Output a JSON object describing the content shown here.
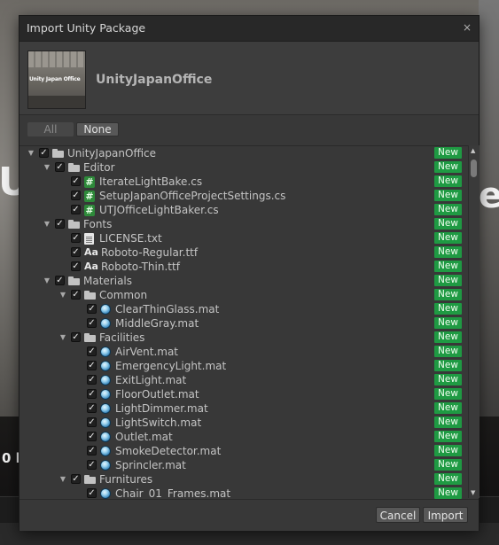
{
  "background": {
    "letter_large_left": "U",
    "letter_large_right": "e",
    "letter_small_left": "0 l"
  },
  "dialog": {
    "title": "Import Unity Package",
    "close_glyph": "×",
    "thumbnail_text": "Unity Japan Office",
    "package_name": "UnityJapanOffice",
    "all_label": "All",
    "none_label": "None",
    "new_badge": "New",
    "cancel_label": "Cancel",
    "import_label": "Import"
  },
  "tree": [
    {
      "label": "UnityJapanOffice",
      "depth": 0,
      "type": "folder",
      "expandable": true,
      "checked": true
    },
    {
      "label": "Editor",
      "depth": 1,
      "type": "folder",
      "expandable": true,
      "checked": true
    },
    {
      "label": "IterateLightBake.cs",
      "depth": 2,
      "type": "script",
      "expandable": false,
      "checked": true
    },
    {
      "label": "SetupJapanOfficeProjectSettings.cs",
      "depth": 2,
      "type": "script",
      "expandable": false,
      "checked": true
    },
    {
      "label": "UTJOfficeLightBaker.cs",
      "depth": 2,
      "type": "script",
      "expandable": false,
      "checked": true
    },
    {
      "label": "Fonts",
      "depth": 1,
      "type": "folder",
      "expandable": true,
      "checked": true
    },
    {
      "label": "LICENSE.txt",
      "depth": 2,
      "type": "doc",
      "expandable": false,
      "checked": true
    },
    {
      "label": "Roboto-Regular.ttf",
      "depth": 2,
      "type": "font",
      "expandable": false,
      "checked": true
    },
    {
      "label": "Roboto-Thin.ttf",
      "depth": 2,
      "type": "font",
      "expandable": false,
      "checked": true
    },
    {
      "label": "Materials",
      "depth": 1,
      "type": "folder",
      "expandable": true,
      "checked": true
    },
    {
      "label": "Common",
      "depth": 2,
      "type": "folder",
      "expandable": true,
      "checked": true
    },
    {
      "label": "ClearThinGlass.mat",
      "depth": 3,
      "type": "mat",
      "expandable": false,
      "checked": true
    },
    {
      "label": "MiddleGray.mat",
      "depth": 3,
      "type": "mat",
      "expandable": false,
      "checked": true
    },
    {
      "label": "Facilities",
      "depth": 2,
      "type": "folder",
      "expandable": true,
      "checked": true
    },
    {
      "label": "AirVent.mat",
      "depth": 3,
      "type": "mat",
      "expandable": false,
      "checked": true
    },
    {
      "label": "EmergencyLight.mat",
      "depth": 3,
      "type": "mat",
      "expandable": false,
      "checked": true
    },
    {
      "label": "ExitLight.mat",
      "depth": 3,
      "type": "mat",
      "expandable": false,
      "checked": true
    },
    {
      "label": "FloorOutlet.mat",
      "depth": 3,
      "type": "mat",
      "expandable": false,
      "checked": true
    },
    {
      "label": "LightDimmer.mat",
      "depth": 3,
      "type": "mat",
      "expandable": false,
      "checked": true
    },
    {
      "label": "LightSwitch.mat",
      "depth": 3,
      "type": "mat",
      "expandable": false,
      "checked": true
    },
    {
      "label": "Outlet.mat",
      "depth": 3,
      "type": "mat",
      "expandable": false,
      "checked": true
    },
    {
      "label": "SmokeDetector.mat",
      "depth": 3,
      "type": "mat",
      "expandable": false,
      "checked": true
    },
    {
      "label": "Sprincler.mat",
      "depth": 3,
      "type": "mat",
      "expandable": false,
      "checked": true
    },
    {
      "label": "Furnitures",
      "depth": 2,
      "type": "folder",
      "expandable": true,
      "checked": true
    },
    {
      "label": "Chair_01_Frames.mat",
      "depth": 3,
      "type": "mat",
      "expandable": false,
      "checked": true
    }
  ],
  "colors": {
    "new_badge": "#1f9a43",
    "dialog_bg": "#383838",
    "titlebar_bg": "#282828"
  }
}
